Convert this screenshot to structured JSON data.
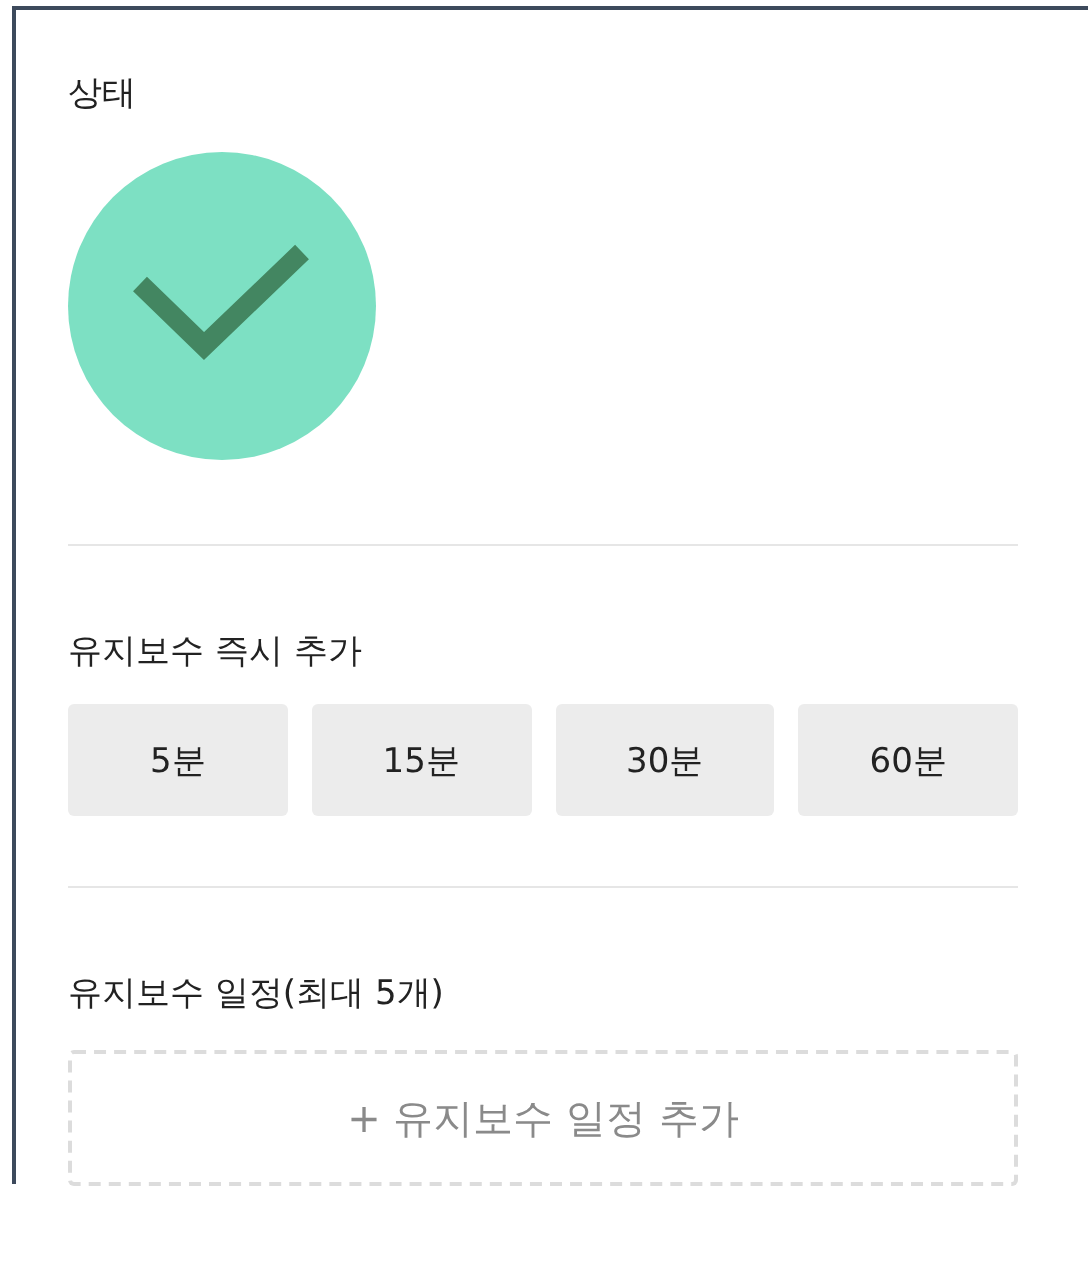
{
  "status": {
    "label": "상태",
    "ok": true
  },
  "quick_add": {
    "label": "유지보수 즉시 추가",
    "buttons": [
      "5분",
      "15분",
      "30분",
      "60분"
    ]
  },
  "schedule": {
    "label": "유지보수 일정(최대 5개)",
    "add_button": "+ 유지보수 일정 추가"
  }
}
